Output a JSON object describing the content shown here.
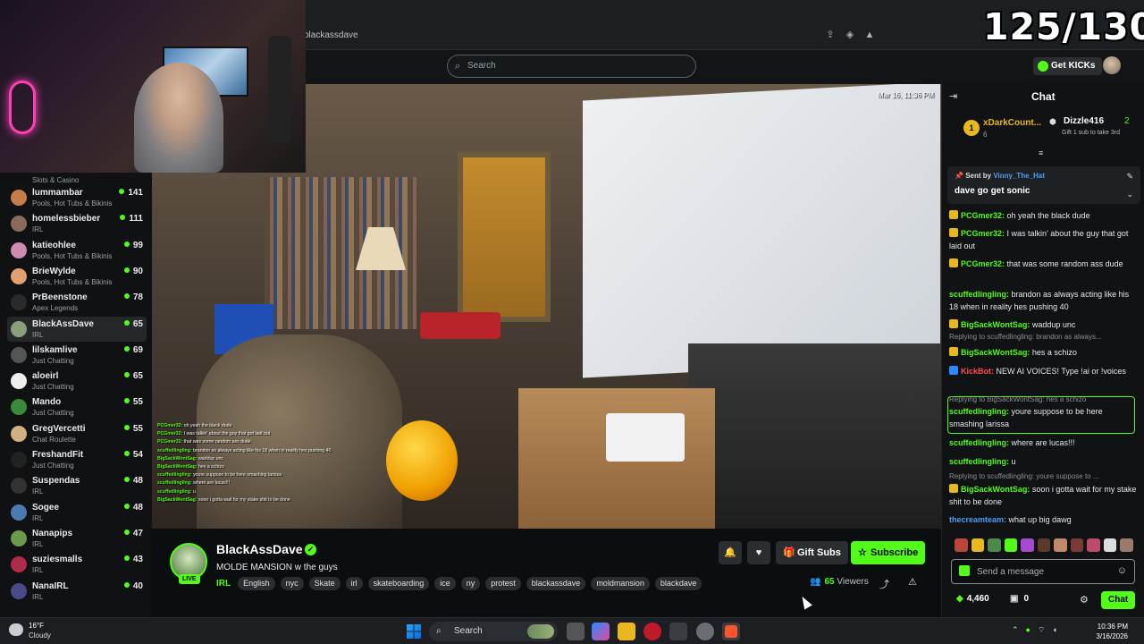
{
  "browser": {
    "address": "blackassdave",
    "counter": "125/130"
  },
  "header": {
    "search_placeholder": "Search",
    "get_kicks_label": "Get KICKs"
  },
  "sidebar": {
    "top_category": "Slots & Casino",
    "items": [
      {
        "name": "lummambar",
        "category": "Pools, Hot Tubs & Bikinis",
        "viewers": "141",
        "color": "#c77d4a"
      },
      {
        "name": "homelessbieber",
        "category": "IRL",
        "viewers": "111",
        "color": "#8a6a5a"
      },
      {
        "name": "katieohlee",
        "category": "Pools, Hot Tubs & Bikinis",
        "viewers": "99",
        "color": "#d08ab0"
      },
      {
        "name": "BrieWylde",
        "category": "Pools, Hot Tubs & Bikinis",
        "viewers": "90",
        "color": "#e0a070"
      },
      {
        "name": "PrBeenstone",
        "category": "Apex Legends",
        "viewers": "78",
        "color": "#2a2a2a"
      },
      {
        "name": "BlackAssDave",
        "category": "IRL",
        "viewers": "65",
        "color": "#8aa07a"
      },
      {
        "name": "lilskamlive",
        "category": "Just Chatting",
        "viewers": "69",
        "color": "#555"
      },
      {
        "name": "aloeirl",
        "category": "Just Chatting",
        "viewers": "65",
        "color": "#eee"
      },
      {
        "name": "Mando",
        "category": "Just Chatting",
        "viewers": "55",
        "color": "#3a8a3a"
      },
      {
        "name": "GregVercetti",
        "category": "Chat Roulette",
        "viewers": "55",
        "color": "#d0b080"
      },
      {
        "name": "FreshandFit",
        "category": "Just Chatting",
        "viewers": "54",
        "color": "#222"
      },
      {
        "name": "Suspendas",
        "category": "IRL",
        "viewers": "48",
        "color": "#333"
      },
      {
        "name": "Sogee",
        "category": "IRL",
        "viewers": "48",
        "color": "#4a7ab0"
      },
      {
        "name": "Nanapips",
        "category": "IRL",
        "viewers": "47",
        "color": "#6a9a4a"
      },
      {
        "name": "suziesmalls",
        "category": "IRL",
        "viewers": "43",
        "color": "#b02a4a"
      },
      {
        "name": "NanaIRL",
        "category": "IRL",
        "viewers": "40",
        "color": "#4a4a8a"
      }
    ]
  },
  "video": {
    "timestamp": "Mar 16, 11:36 PM",
    "overlay_lines": [
      {
        "user": "PCGmer32:",
        "text": "oh yeah the black dude"
      },
      {
        "user": "PCGmer32:",
        "text": "I was talkin' about the guy that got laid out"
      },
      {
        "user": "PCGmer32:",
        "text": "that was some random ass dude"
      },
      {
        "user": "scuffedlingling:",
        "text": "brandon as always acting like his 18 when in reality hes pushing 40"
      },
      {
        "user": "BigSackWontSag:",
        "text": "waddup unc"
      },
      {
        "user": "BigSackWontSag:",
        "text": "hes a schizo"
      },
      {
        "user": "scuffedlingling:",
        "text": "youre suppose to be here smashing larissa"
      },
      {
        "user": "scuffedlingling:",
        "text": "where are lucas!!!"
      },
      {
        "user": "scuffedlingling:",
        "text": "u"
      },
      {
        "user": "BigSackWontSag:",
        "text": "soon i gotta wait for my stake shit to be done"
      }
    ]
  },
  "stream": {
    "streamer": "BlackAssDave",
    "live_label": "LIVE",
    "title": "MOLDE MANSION w the guys",
    "category": "IRL",
    "tags": [
      "English",
      "nyc",
      "Skate",
      "irl",
      "skateboarding",
      "ice",
      "ny",
      "protest",
      "blackassdave",
      "moldmansion",
      "blackdave"
    ],
    "gift_label": "Gift Subs",
    "subscribe_label": "Subscribe",
    "viewer_count": "65",
    "viewers_label": "Viewers"
  },
  "chat": {
    "title": "Chat",
    "leaderboard": {
      "first_rank": "1",
      "first_name": "xDarkCount...",
      "first_value": "6",
      "second_name": "Dizzle416",
      "second_value": "2",
      "second_note": "Gift 1 sub to take 3rd"
    },
    "pinned": {
      "sent_by": "Sent by",
      "user": "Vinny_The_Hat",
      "message": "dave go get sonic"
    },
    "messages": [
      {
        "user": "PCGmer32:",
        "text": "oh yeah the black dude",
        "color": "#53fc18",
        "badge": "#e9b71f"
      },
      {
        "user": "PCGmer32:",
        "text": "I was talkin' about the guy that got laid out",
        "color": "#53fc18",
        "badge": "#e9b71f"
      },
      {
        "user": "PCGmer32:",
        "text": "that was some random ass dude",
        "color": "#53fc18",
        "badge": "#e9b71f"
      },
      {
        "user": "scuffedlingling:",
        "text": "brandon as always acting like his 18 when in reality hes pushing 40",
        "color": "#53fc18",
        "badge": ""
      },
      {
        "user": "BigSackWontSag:",
        "text": "waddup unc",
        "color": "#53fc18",
        "badge": "#e9b71f"
      },
      {
        "user": "BigSackWontSag:",
        "text": "hes a schizo",
        "color": "#53fc18",
        "badge": "#e9b71f"
      },
      {
        "user": "KickBot:",
        "text": "NEW AI VOICES! Type !ai or !voices",
        "color": "#ff4d4d",
        "badge": "#2a8aff"
      },
      {
        "user": "scuffedlingling:",
        "text": "youre suppose to be here smashing larissa",
        "color": "#53fc18",
        "badge": ""
      },
      {
        "user": "scuffedlingling:",
        "text": "where are lucas!!!",
        "color": "#53fc18",
        "badge": ""
      },
      {
        "user": "scuffedlingling:",
        "text": "u",
        "color": "#53fc18",
        "badge": ""
      },
      {
        "user": "BigSackWontSag:",
        "text": "soon i gotta wait for my stake shit to be done",
        "color": "#53fc18",
        "badge": "#e9b71f"
      },
      {
        "user": "thecreamteam:",
        "text": "what up big dawg",
        "color": "#4f9cf6",
        "badge": ""
      }
    ],
    "replies": [
      "Replying to scuffedlingling: brandon as always...",
      "Replying to BigSackWontSag: hes a schizo",
      "Replying to scuffedlingling: youre suppose to ..."
    ],
    "input_placeholder": "Send a message",
    "kicks": "4,460",
    "gifts": "0",
    "chat_button": "Chat"
  },
  "taskbar": {
    "temperature": "16°F",
    "condition": "Cloudy",
    "search_label": "Search",
    "time": "10:36 PM",
    "date": "3/16/2026"
  }
}
